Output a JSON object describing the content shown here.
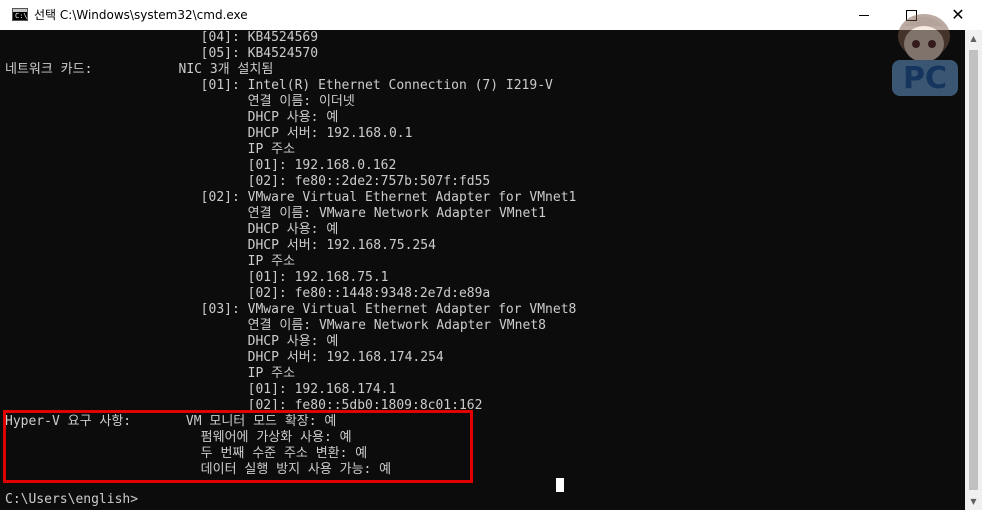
{
  "window": {
    "title": "선택 C:\\Windows\\system32\\cmd.exe",
    "icon": "cmd-icon",
    "controls": [
      "minimize-icon",
      "maximize-icon",
      "close-icon"
    ]
  },
  "console": {
    "lines": [
      "                         [04]: KB4524569",
      "                         [05]: KB4524570",
      "네트워크 카드:           NIC 3개 설치됨",
      "                         [01]: Intel(R) Ethernet Connection (7) I219-V",
      "                               연결 이름: 이더넷",
      "                               DHCP 사용: 예",
      "                               DHCP 서버: 192.168.0.1",
      "                               IP 주소",
      "                               [01]: 192.168.0.162",
      "                               [02]: fe80::2de2:757b:507f:fd55",
      "                         [02]: VMware Virtual Ethernet Adapter for VMnet1",
      "                               연결 이름: VMware Network Adapter VMnet1",
      "                               DHCP 사용: 예",
      "                               DHCP 서버: 192.168.75.254",
      "                               IP 주소",
      "                               [01]: 192.168.75.1",
      "                               [02]: fe80::1448:9348:2e7d:e89a",
      "                         [03]: VMware Virtual Ethernet Adapter for VMnet8",
      "                               연결 이름: VMware Network Adapter VMnet8",
      "                               DHCP 사용: 예",
      "                               DHCP 서버: 192.168.174.254",
      "                               IP 주소",
      "                               [01]: 192.168.174.1",
      "                               [02]: fe80::5db0:1809:8c01:162",
      "Hyper-V 요구 사항:       VM 모니터 모드 확장: 예",
      "                         펌웨어에 가상화 사용: 예",
      "                         두 번째 수준 주소 변환: 예",
      "                         데이터 실행 방지 사용 가능: 예",
      "",
      "C:\\Users\\english>"
    ]
  },
  "colors": {
    "console_bg": "#0c0c0c",
    "console_text": "#cccccc",
    "highlight": "#e00000"
  },
  "watermark": {
    "text": "PC"
  }
}
